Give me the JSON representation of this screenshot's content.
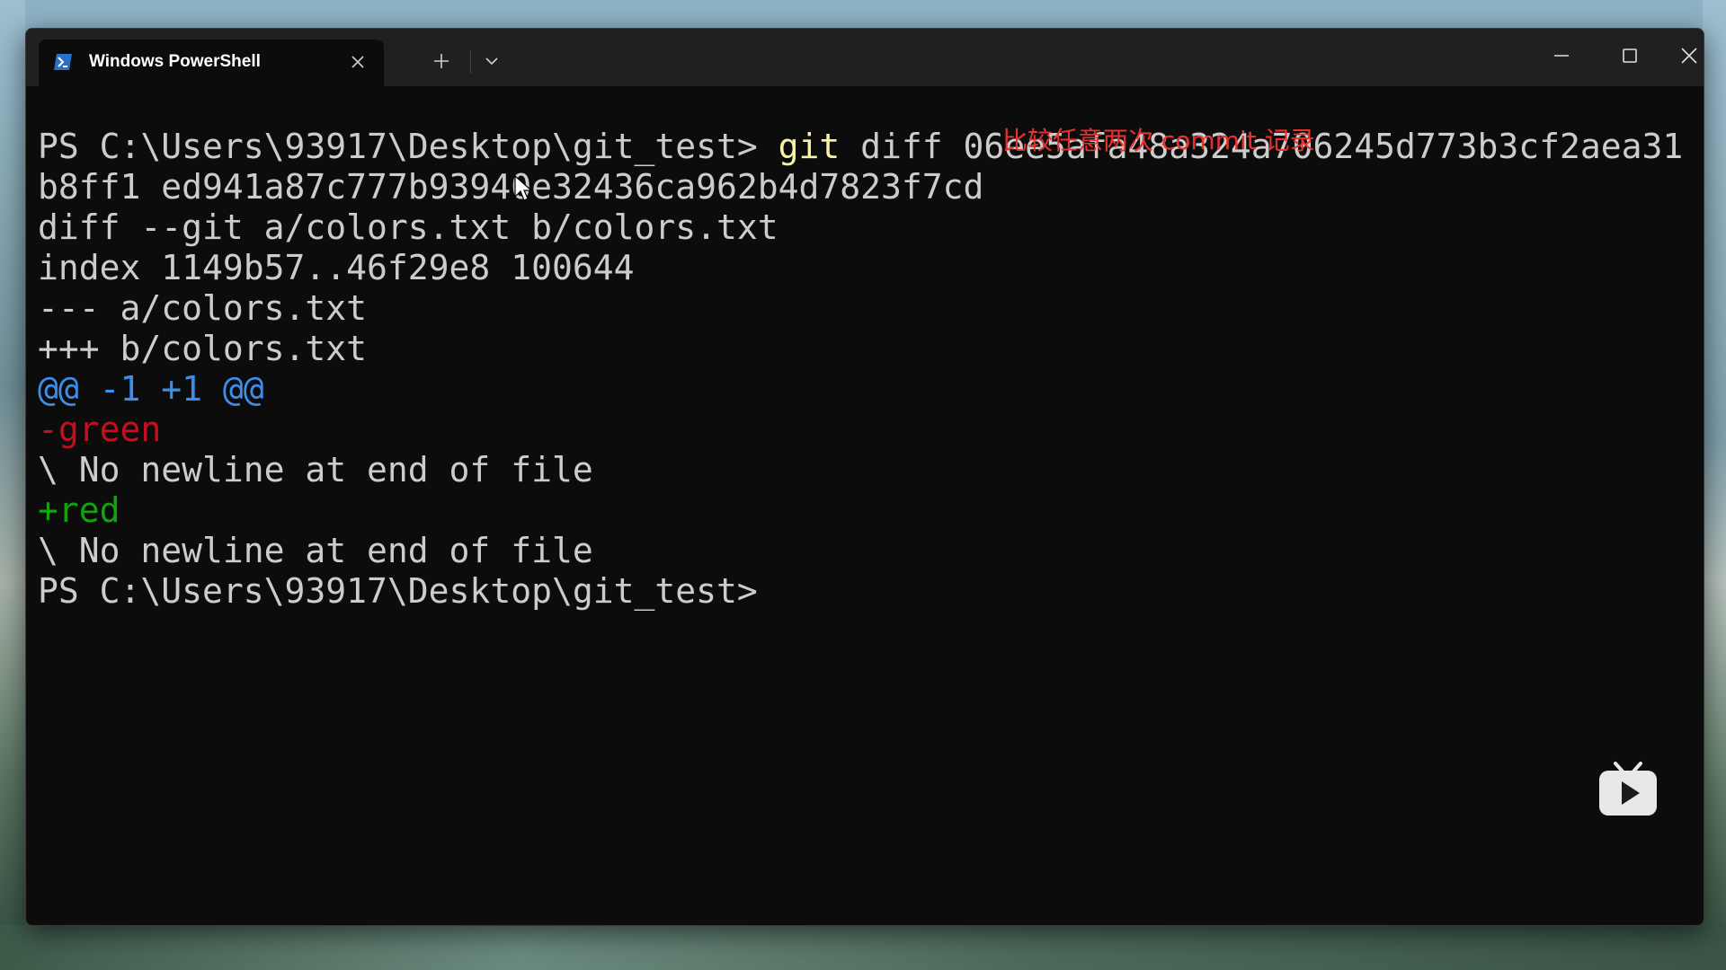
{
  "window": {
    "tab_title": "Windows PowerShell",
    "tab_icon": "powershell-icon",
    "controls": {
      "close_tab_icon": "close-icon",
      "new_tab_icon": "plus-icon",
      "dropdown_icon": "chevron-down-icon",
      "minimize_icon": "minimize-icon",
      "maximize_icon": "maximize-icon",
      "close_window_icon": "close-icon"
    }
  },
  "terminal": {
    "lines": [
      {
        "prompt": "PS C:\\Users\\93917\\Desktop\\git_test> ",
        "cmd": "git",
        "rest": " diff 06ee5afa48a324a706245d773b3cf2aea31"
      },
      {
        "text": "b8ff1 ed941a87c777b93940e32436ca962b4d7823f7cd"
      },
      {
        "text": "diff --git a/colors.txt b/colors.txt"
      },
      {
        "text": "index 1149b57..46f29e8 100644"
      },
      {
        "text": "--- a/colors.txt"
      },
      {
        "text": "+++ b/colors.txt"
      },
      {
        "text": "@@ -1 +1 @@"
      },
      {
        "text": "-green"
      },
      {
        "text": "\\ No newline at end of file"
      },
      {
        "text": "+red"
      },
      {
        "text": "\\ No newline at end of file"
      },
      {
        "text": "PS C:\\Users\\93917\\Desktop\\git_test>"
      }
    ]
  },
  "annotation": "比较任意两次 commit 记录",
  "colors": {
    "background": "#0c0c0c",
    "titlebar": "#202020",
    "default_text": "#cccccc",
    "command": "#f9f1a5",
    "hunk_header": "#3b8eea",
    "deletion": "#c50f1f",
    "addition": "#13a10e",
    "annotation": "#e8312f"
  },
  "watermark_icon": "bilibili-tv-play-icon"
}
